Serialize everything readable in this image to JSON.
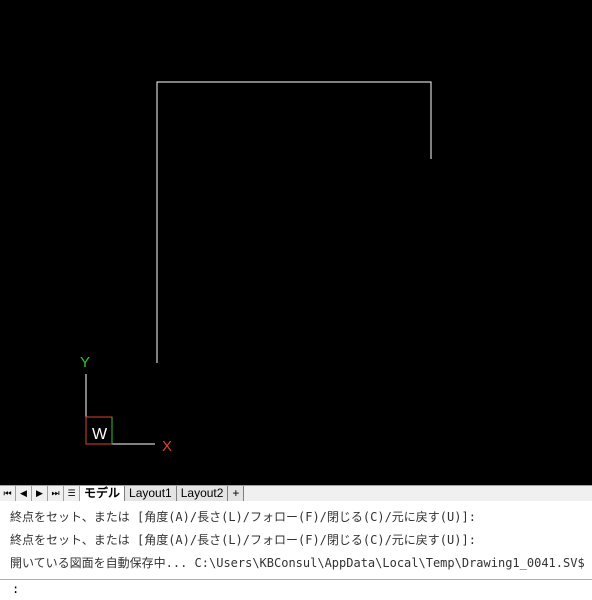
{
  "canvas": {
    "background": "#000000",
    "line_color": "#ffffff",
    "ucs": {
      "y_label": "Y",
      "x_label": "X",
      "w_label": "W",
      "y_color": "#2ec42e",
      "x_color": "#d9452b",
      "axis_color": "#ffffff"
    }
  },
  "tabs": {
    "nav_first": "⏮",
    "nav_prev": "◀",
    "nav_next": "▶",
    "nav_last": "⏭",
    "nav_list": "☰",
    "items": [
      {
        "label": "モデル",
        "active": true
      },
      {
        "label": "Layout1",
        "active": false
      },
      {
        "label": "Layout2",
        "active": false
      }
    ],
    "add_label": "+"
  },
  "command": {
    "history": [
      "終点をセット、または [角度(A)/長さ(L)/フォロー(F)/閉じる(C)/元に戻す(U)]:",
      "終点をセット、または [角度(A)/長さ(L)/フォロー(F)/閉じる(C)/元に戻す(U)]:",
      "開いている図面を自動保存中... C:\\Users\\KBConsul\\AppData\\Local\\Temp\\Drawing1_0041.SV$"
    ],
    "prompt": ":",
    "input_value": ""
  }
}
